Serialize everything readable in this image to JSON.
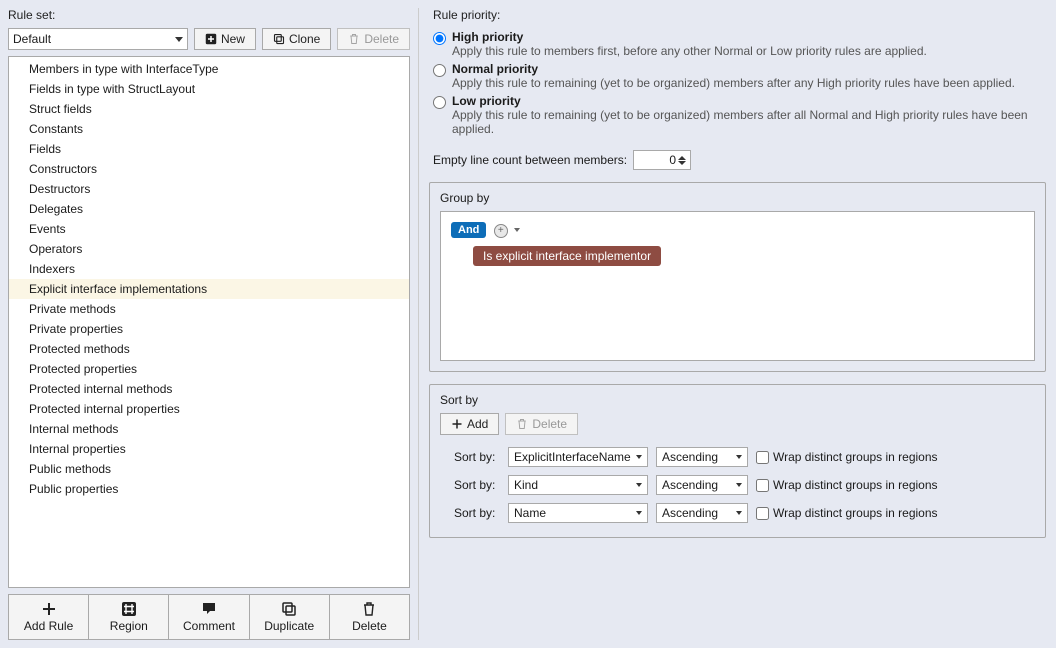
{
  "left": {
    "ruleset_label": "Rule set:",
    "ruleset_value": "Default",
    "btn_new": "New",
    "btn_clone": "Clone",
    "btn_delete": "Delete",
    "rules": [
      "Members in type with InterfaceType",
      "Fields in type with StructLayout",
      "Struct fields",
      "Constants",
      "Fields",
      "Constructors",
      "Destructors",
      "Delegates",
      "Events",
      "Operators",
      "Indexers",
      "Explicit interface implementations",
      "Private methods",
      "Private properties",
      "Protected methods",
      "Protected properties",
      "Protected internal methods",
      "Protected internal properties",
      "Internal methods",
      "Internal properties",
      "Public methods",
      "Public properties"
    ],
    "selected_index": 11,
    "toolbar": {
      "add_rule": "Add Rule",
      "region": "Region",
      "comment": "Comment",
      "duplicate": "Duplicate",
      "delete": "Delete"
    }
  },
  "right": {
    "priority_label": "Rule priority:",
    "priority": [
      {
        "title": "High priority",
        "desc": "Apply this rule to members first, before any other Normal or Low priority rules are applied.",
        "checked": true
      },
      {
        "title": "Normal priority",
        "desc": "Apply this rule to remaining (yet to be organized) members after any High priority rules have been applied.",
        "checked": false
      },
      {
        "title": "Low priority",
        "desc": "Apply this rule to remaining (yet to be organized) members after all Normal and High priority rules have been applied.",
        "checked": false
      }
    ],
    "empty_line_label": "Empty line count between members:",
    "empty_line_value": "0",
    "groupby": {
      "title": "Group by",
      "and_label": "And",
      "condition": "Is explicit interface implementor"
    },
    "sortby": {
      "title": "Sort by",
      "btn_add": "Add",
      "btn_delete": "Delete",
      "row_label": "Sort by:",
      "wrap_label": "Wrap distinct groups in regions",
      "rows": [
        {
          "field": "ExplicitInterfaceName",
          "dir": "Ascending",
          "wrap": false
        },
        {
          "field": "Kind",
          "dir": "Ascending",
          "wrap": false
        },
        {
          "field": "Name",
          "dir": "Ascending",
          "wrap": false
        }
      ]
    }
  }
}
